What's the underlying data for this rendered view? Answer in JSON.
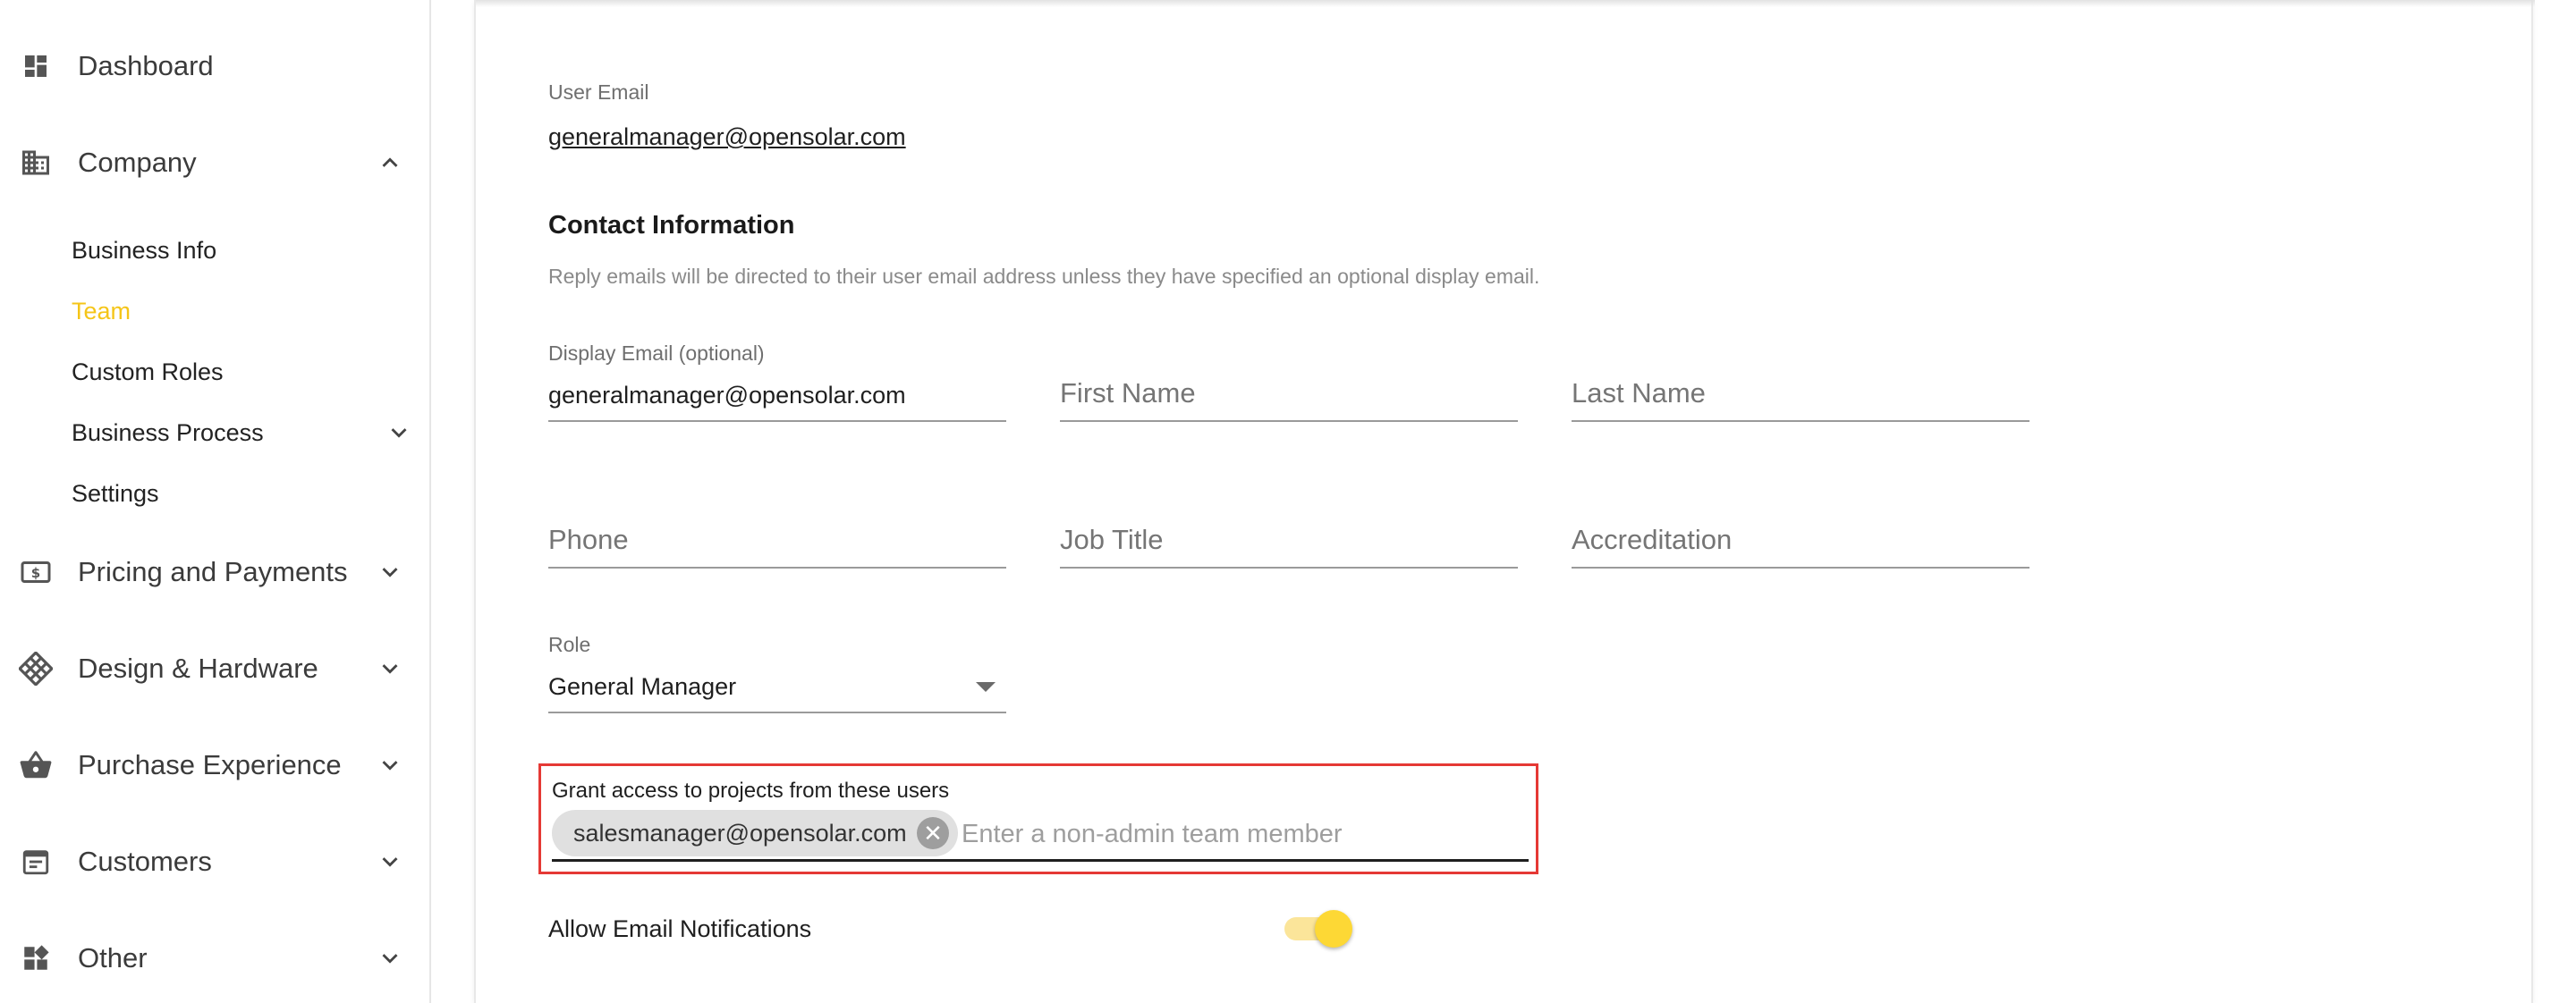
{
  "sidebar": {
    "items": [
      {
        "label": "Dashboard",
        "icon": "dashboard-icon"
      },
      {
        "label": "Company",
        "icon": "building-icon"
      },
      {
        "label": "Pricing and Payments",
        "icon": "dollar-bill-icon"
      },
      {
        "label": "Design & Hardware",
        "icon": "grid-diamond-icon"
      },
      {
        "label": "Purchase Experience",
        "icon": "basket-icon"
      },
      {
        "label": "Customers",
        "icon": "calendar-icon"
      },
      {
        "label": "Other",
        "icon": "widgets-icon"
      }
    ],
    "company_sub": [
      "Business Info",
      "Team",
      "Custom Roles",
      "Business Process",
      "Settings"
    ],
    "active_sub": "Team"
  },
  "form": {
    "user_email_label": "User Email",
    "user_email": "generalmanager@opensolar.com",
    "contact_title": "Contact Information",
    "contact_help": "Reply emails will be directed to their user email address unless they have specified an optional display email.",
    "display_email_label": "Display Email (optional)",
    "display_email": "generalmanager@opensolar.com",
    "first_name_placeholder": "First Name",
    "last_name_placeholder": "Last Name",
    "phone_placeholder": "Phone",
    "job_title_placeholder": "Job Title",
    "accreditation_placeholder": "Accreditation",
    "role_label": "Role",
    "role_value": "General Manager",
    "grant_label": "Grant access to projects from these users",
    "grant_chip": "salesmanager@opensolar.com",
    "grant_placeholder": "Enter a non-admin team member",
    "notifications_label": "Allow Email Notifications",
    "notifications_enabled": true
  },
  "colors": {
    "accent": "#f5c518",
    "highlight_border": "#e53935"
  }
}
